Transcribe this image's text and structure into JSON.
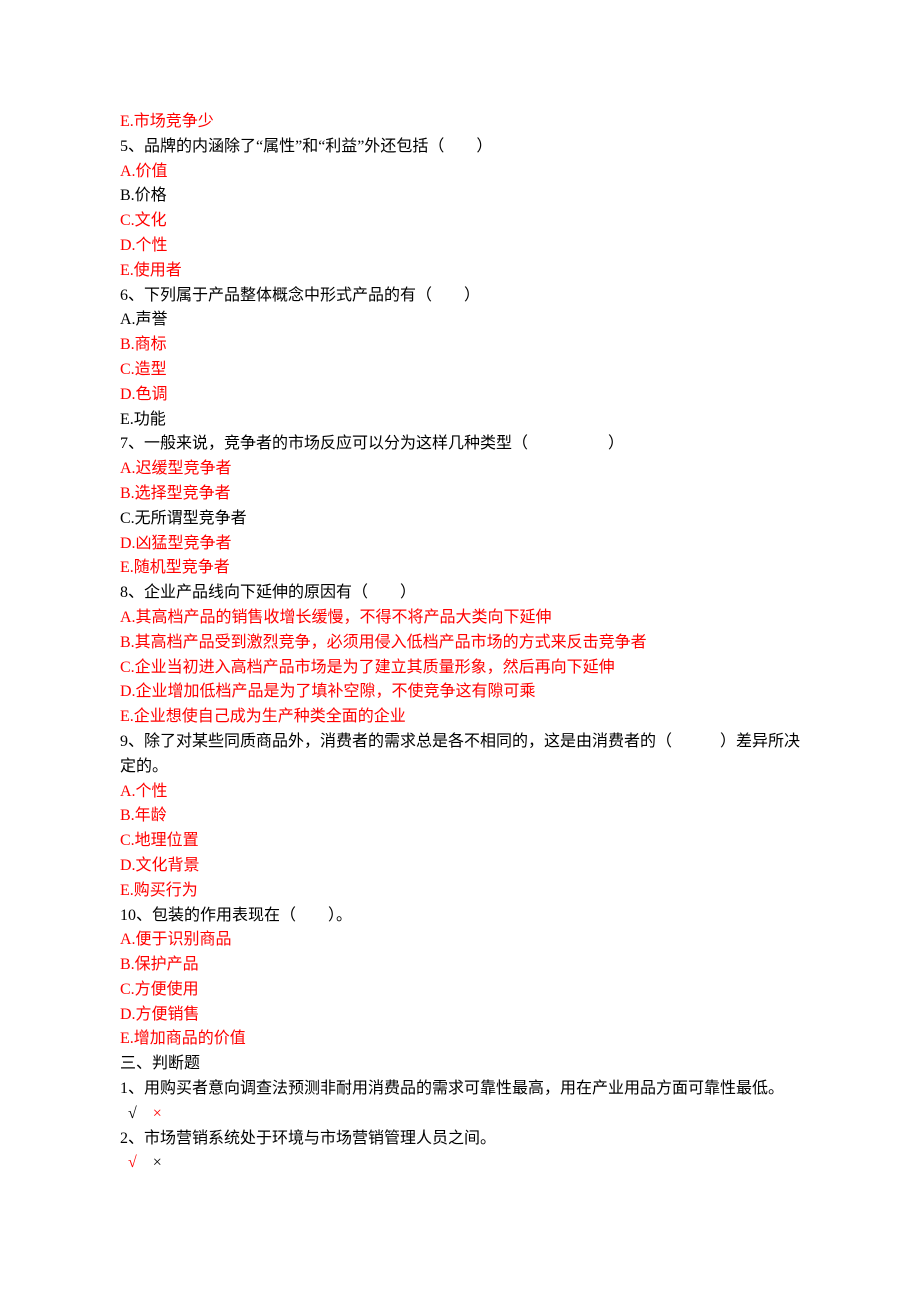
{
  "lines": [
    {
      "text": "E.市场竞争少",
      "red": true
    },
    {
      "text": "5、品牌的内涵除了“属性”和“利益”外还包括（　　）",
      "red": false
    },
    {
      "text": "A.价值",
      "red": true
    },
    {
      "text": "B.价格",
      "red": false
    },
    {
      "text": "C.文化",
      "red": true
    },
    {
      "text": "D.个性",
      "red": true
    },
    {
      "text": "E.使用者",
      "red": true
    },
    {
      "text": "6、下列属于产品整体概念中形式产品的有（　　）",
      "red": false
    },
    {
      "text": "A.声誉",
      "red": false
    },
    {
      "text": "B.商标",
      "red": true
    },
    {
      "text": "C.造型",
      "red": true
    },
    {
      "text": "D.色调",
      "red": true
    },
    {
      "text": "E.功能",
      "red": false
    },
    {
      "text": "7、一般来说，竞争者的市场反应可以分为这样几种类型（　　　　　）",
      "red": false
    },
    {
      "text": "A.迟缓型竞争者",
      "red": true
    },
    {
      "text": "B.选择型竞争者",
      "red": true
    },
    {
      "text": "C.无所谓型竞争者",
      "red": false
    },
    {
      "text": "D.凶猛型竞争者",
      "red": true
    },
    {
      "text": "E.随机型竞争者",
      "red": true
    },
    {
      "text": "8、企业产品线向下延伸的原因有（　　）",
      "red": false
    },
    {
      "text": "A.其高档产品的销售收增长缓慢，不得不将产品大类向下延伸",
      "red": true
    },
    {
      "text": "B.其高档产品受到激烈竞争，必须用侵入低档产品市场的方式来反击竞争者",
      "red": true
    },
    {
      "text": "C.企业当初进入高档产品市场是为了建立其质量形象，然后再向下延伸",
      "red": true
    },
    {
      "text": "D.企业增加低档产品是为了填补空隙，不使竞争这有隙可乘",
      "red": true
    },
    {
      "text": "E.企业想使自己成为生产种类全面的企业",
      "red": true
    },
    {
      "text": "9、除了对某些同质商品外，消费者的需求总是各不相同的，这是由消费者的（　　　）差异所决定的。",
      "red": false
    },
    {
      "text": "A.个性",
      "red": true
    },
    {
      "text": "B.年龄",
      "red": true
    },
    {
      "text": "C.地理位置",
      "red": true
    },
    {
      "text": "D.文化背景",
      "red": true
    },
    {
      "text": "E.购买行为",
      "red": true
    },
    {
      "text": "10、包装的作用表现在（　　）。",
      "red": false
    },
    {
      "text": "A.便于识别商品",
      "red": true
    },
    {
      "text": "B.保护产品",
      "red": true
    },
    {
      "text": "C.方便使用",
      "red": true
    },
    {
      "text": "D.方便销售",
      "red": true
    },
    {
      "text": "E.增加商品的价值",
      "red": true
    },
    {
      "text": "三、判断题",
      "red": false
    },
    {
      "text": "1、用购买者意向调查法预测非耐用消费品的需求可靠性最高，用在产业用品方面可靠性最低。",
      "red": false
    }
  ],
  "judge1": {
    "check": "√",
    "cross": "×",
    "indent": true,
    "crossRed": true
  },
  "q2": "2、市场营销系统处于环境与市场营销管理人员之间。",
  "judge2": {
    "check": "√",
    "cross": "×",
    "indent": true,
    "checkRed": true
  }
}
